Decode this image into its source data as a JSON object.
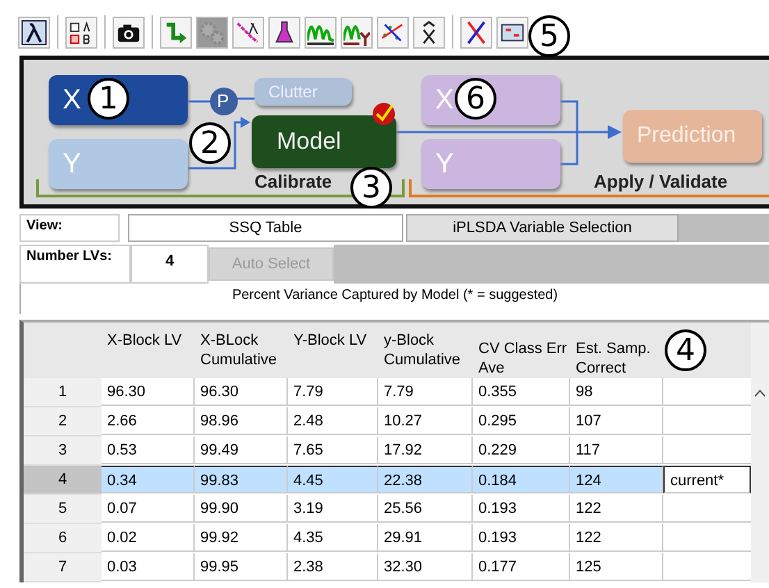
{
  "toolbar": [
    {
      "kind": "lambda",
      "disabled": false
    },
    {
      "kind": "abbox",
      "disabled": false
    },
    {
      "kind": "camera",
      "disabled": false
    },
    {
      "kind": "steparrow",
      "disabled": false
    },
    {
      "kind": "gears",
      "disabled": true
    },
    {
      "kind": "lambdaline",
      "disabled": false
    },
    {
      "kind": "flask",
      "disabled": false
    },
    {
      "kind": "peaks",
      "disabled": false
    },
    {
      "kind": "peaksy",
      "disabled": false
    },
    {
      "kind": "scatter",
      "disabled": false
    },
    {
      "kind": "xhat",
      "disabled": false
    },
    {
      "kind": "cross",
      "disabled": false
    },
    {
      "kind": "grid",
      "disabled": false
    }
  ],
  "flow": {
    "x_block": {
      "label": "X",
      "loaded": true
    },
    "y_block": {
      "label": "Y",
      "loaded": false
    },
    "preprocess": {
      "label": "P"
    },
    "clutter": {
      "label": "Clutter"
    },
    "model": {
      "label": "Model",
      "calibrated": true
    },
    "calibrate_label": "Calibrate",
    "x_val": {
      "label": "X"
    },
    "y_val": {
      "label": "Y"
    },
    "prediction": {
      "label": "Prediction"
    },
    "apply_label": "Apply / Validate"
  },
  "view": {
    "label": "View:",
    "tabs": [
      {
        "label": "SSQ Table",
        "selected": true
      },
      {
        "label": "iPLSDA Variable Selection",
        "selected": false
      }
    ]
  },
  "lvs": {
    "label": "Number LVs:",
    "value": "4",
    "button": "Auto Select"
  },
  "table_title": "Percent Variance Captured by Model (* = suggested)",
  "table": {
    "columns": [
      "X-Block LV",
      "X-BLock Cumulative",
      "Y-Block LV",
      "y-Block Cumulative",
      "CV Class Err Ave",
      "Est. Samp. Correct"
    ],
    "rows": [
      {
        "index": "1",
        "cells": [
          "96.30",
          "96.30",
          "7.79",
          "7.79",
          "0.355",
          "98"
        ],
        "note": "",
        "selected": false
      },
      {
        "index": "2",
        "cells": [
          "2.66",
          "98.96",
          "2.48",
          "10.27",
          "0.295",
          "107"
        ],
        "note": "",
        "selected": false
      },
      {
        "index": "3",
        "cells": [
          "0.53",
          "99.49",
          "7.65",
          "17.92",
          "0.229",
          "117"
        ],
        "note": "",
        "selected": false
      },
      {
        "index": "4",
        "cells": [
          "0.34",
          "99.83",
          "4.45",
          "22.38",
          "0.184",
          "124"
        ],
        "note": "current*",
        "selected": true
      },
      {
        "index": "5",
        "cells": [
          "0.07",
          "99.90",
          "3.19",
          "25.56",
          "0.193",
          "122"
        ],
        "note": "",
        "selected": false
      },
      {
        "index": "6",
        "cells": [
          "0.02",
          "99.92",
          "4.35",
          "29.91",
          "0.193",
          "122"
        ],
        "note": "",
        "selected": false
      },
      {
        "index": "7",
        "cells": [
          "0.03",
          "99.95",
          "2.38",
          "32.30",
          "0.177",
          "125"
        ],
        "note": "",
        "selected": false
      }
    ]
  },
  "callouts": [
    {
      "label": "1"
    },
    {
      "label": "2"
    },
    {
      "label": "3"
    },
    {
      "label": "4"
    },
    {
      "label": "5"
    },
    {
      "label": "6"
    }
  ]
}
